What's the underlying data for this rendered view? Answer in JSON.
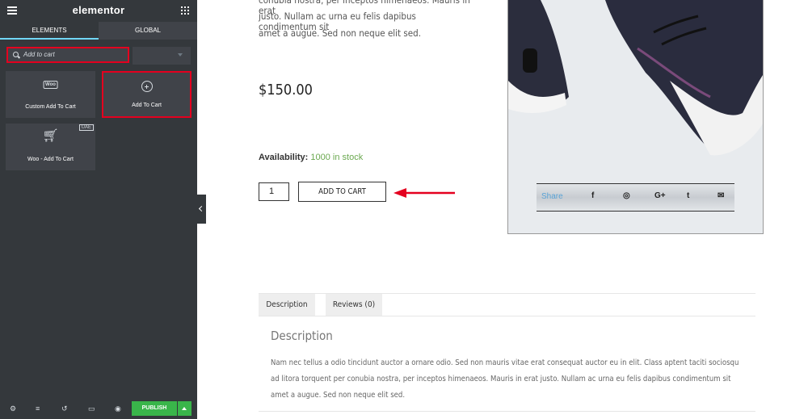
{
  "editor": {
    "logo": "elementor",
    "tabs": [
      {
        "label": "ELEMENTS"
      },
      {
        "label": "GLOBAL"
      }
    ],
    "search": {
      "value": "Add to cart"
    },
    "widgets": [
      {
        "label": "Custom Add To Cart",
        "icon": "woo-icon",
        "icon_text": "Woo"
      },
      {
        "label": "Add To Cart",
        "icon": "add-to-cart-icon"
      },
      {
        "label": "Woo - Add To Cart",
        "icon": "cart-icon",
        "badge": "UAE"
      }
    ],
    "publish_label": "PUBLISH"
  },
  "product": {
    "text_lines": [
      "conubia nostra, per inceptos himenaeos. Mauris in erat",
      "justo. Nullam ac urna eu felis dapibus condimentum sit",
      "amet a augue. Sed non neque elit sed."
    ],
    "price": "$150.00",
    "availability_label": "Availability:",
    "availability_value": "1000 in stock",
    "quantity": "1",
    "add_to_cart_label": "ADD TO CART",
    "share_label": "Share",
    "accent_color": "#e4001f"
  },
  "product_tabs": {
    "tabs": [
      {
        "label": "Description"
      },
      {
        "label": "Reviews (0)"
      }
    ],
    "heading": "Description",
    "body": "Nam nec tellus a odio tincidunt auctor a ornare odio. Sed non mauris vitae erat consequat auctor eu in elit. Class aptent taciti sociosqu ad litora torquent per conubia nostra, per inceptos himenaeos. Mauris in erat justo. Nullam ac urna eu felis dapibus condimentum sit amet a augue. Sed non neque elit sed."
  }
}
